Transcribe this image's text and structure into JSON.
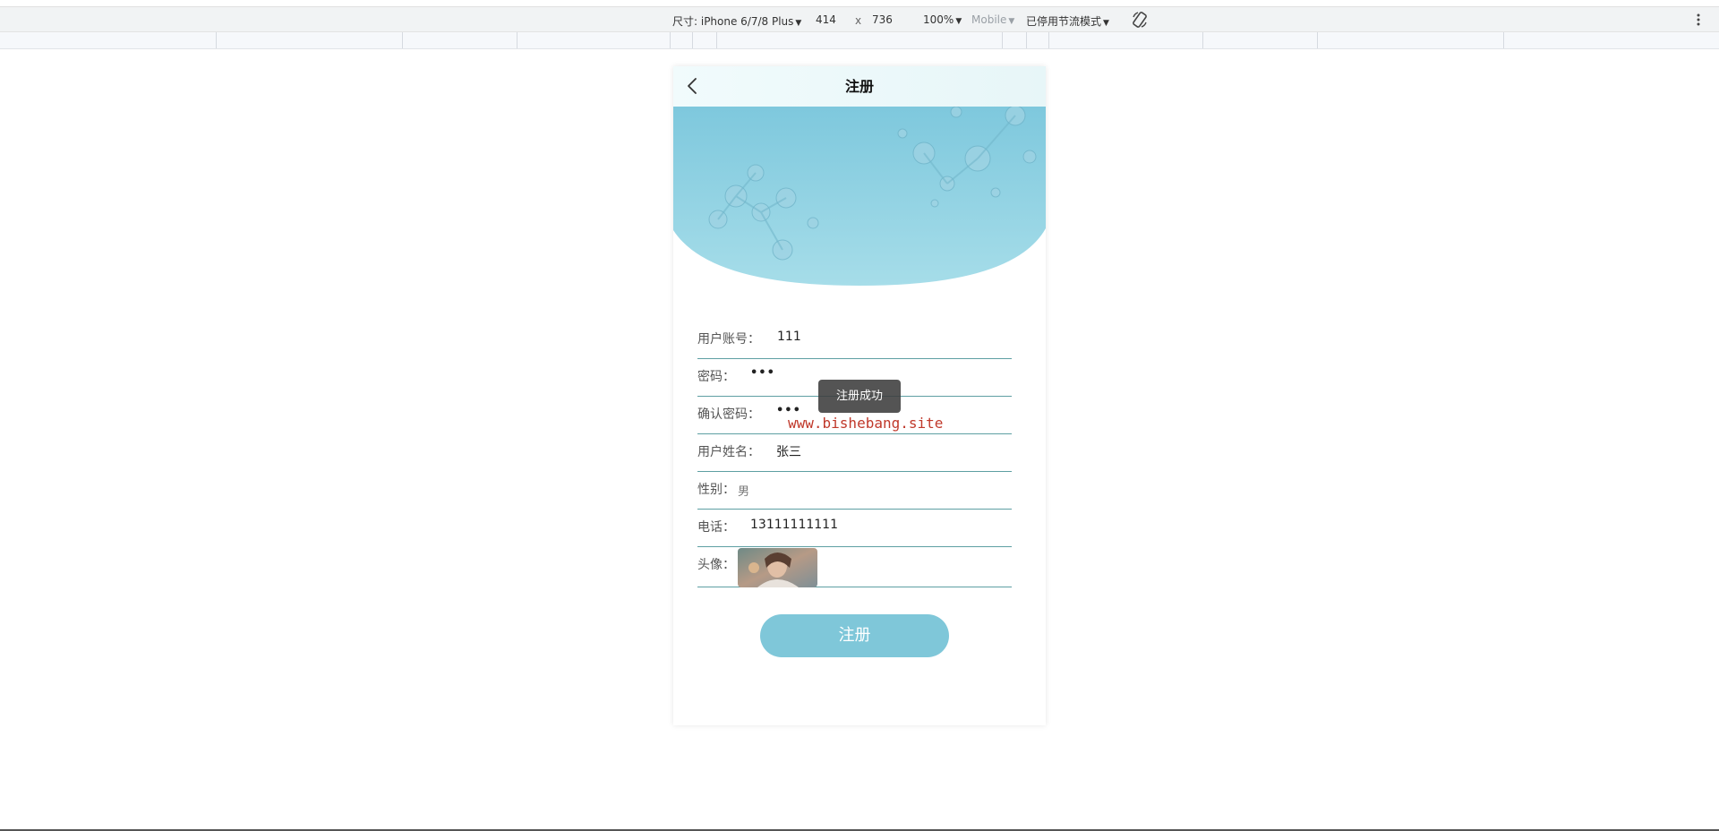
{
  "devtools": {
    "dimensions_label": "尺寸: iPhone 6/7/8 Plus",
    "width": "414",
    "times": "x",
    "height": "736",
    "zoom": "100%",
    "device_type": "Mobile",
    "throttling": "已停用节流模式"
  },
  "nav": {
    "title": "注册"
  },
  "form": {
    "fields": [
      {
        "label": "用户账号：",
        "value": "111"
      },
      {
        "label": "密码：",
        "value": "•••"
      },
      {
        "label": "确认密码：",
        "value": "•••"
      },
      {
        "label": "用户姓名：",
        "value": "张三"
      },
      {
        "label": "性别：",
        "value": "男"
      },
      {
        "label": "电话：",
        "value": "13111111111"
      },
      {
        "label": "头像："
      }
    ],
    "submit_label": "注册"
  },
  "toast": "注册成功",
  "watermark": "www.bishebang.site",
  "colors": {
    "accent": "#7fc7d9",
    "underline": "#5e9fa3",
    "banner": "#8ccfe0"
  }
}
